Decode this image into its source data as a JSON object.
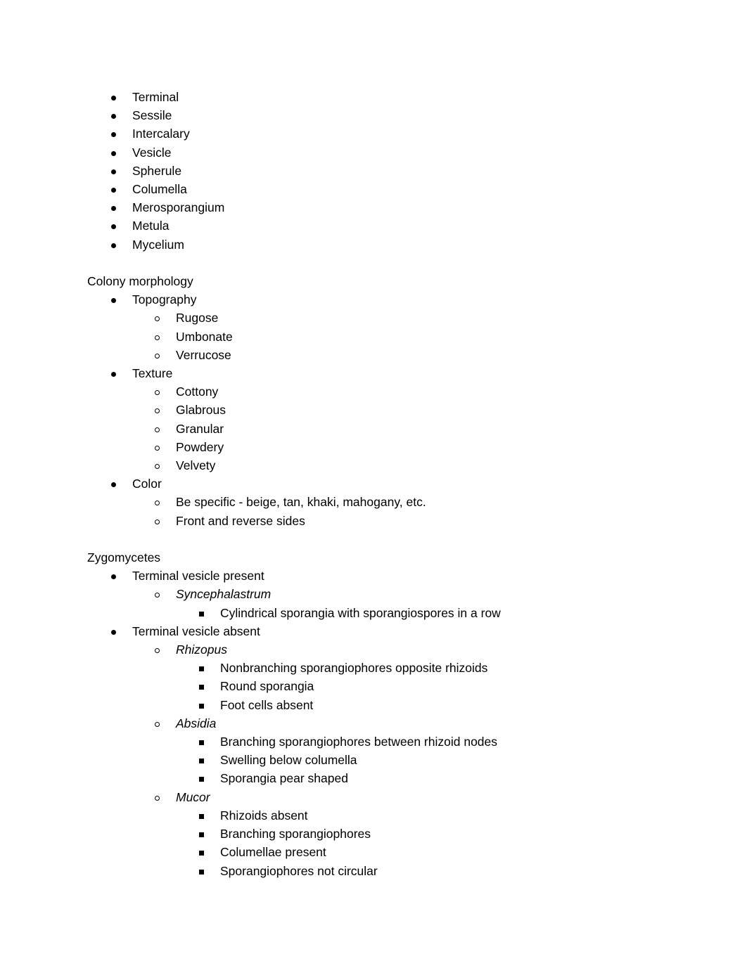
{
  "document": {
    "background_color": "#ffffff",
    "text_color": "#000000",
    "sections": [
      {
        "id": "morphology-terms",
        "heading": null,
        "items": [
          {
            "level": 1,
            "bullet": "disc",
            "text": "Terminal"
          },
          {
            "level": 1,
            "bullet": "disc",
            "text": "Sessile"
          },
          {
            "level": 1,
            "bullet": "disc",
            "text": "Intercalary"
          },
          {
            "level": 1,
            "bullet": "disc",
            "text": "Vesicle"
          },
          {
            "level": 1,
            "bullet": "disc",
            "text": "Spherule"
          },
          {
            "level": 1,
            "bullet": "disc",
            "text": "Columella"
          },
          {
            "level": 1,
            "bullet": "disc",
            "text": "Merosporangium"
          },
          {
            "level": 1,
            "bullet": "disc",
            "text": "Metula"
          },
          {
            "level": 1,
            "bullet": "disc",
            "text": "Mycelium"
          }
        ]
      },
      {
        "id": "colony-morphology",
        "heading": "Colony morphology",
        "items": [
          {
            "level": 1,
            "bullet": "disc",
            "text": "Topography"
          },
          {
            "level": 2,
            "bullet": "circle",
            "text": "Rugose"
          },
          {
            "level": 2,
            "bullet": "circle",
            "text": "Umbonate"
          },
          {
            "level": 2,
            "bullet": "circle",
            "text": "Verrucose"
          },
          {
            "level": 1,
            "bullet": "disc",
            "text": "Texture"
          },
          {
            "level": 2,
            "bullet": "circle",
            "text": "Cottony"
          },
          {
            "level": 2,
            "bullet": "circle",
            "text": "Glabrous"
          },
          {
            "level": 2,
            "bullet": "circle",
            "text": "Granular"
          },
          {
            "level": 2,
            "bullet": "circle",
            "text": "Powdery"
          },
          {
            "level": 2,
            "bullet": "circle",
            "text": "Velvety"
          },
          {
            "level": 1,
            "bullet": "disc",
            "text": "Color"
          },
          {
            "level": 2,
            "bullet": "circle",
            "text": "Be specific - beige, tan, khaki, mahogany, etc."
          },
          {
            "level": 2,
            "bullet": "circle",
            "text": "Front and reverse sides"
          }
        ]
      },
      {
        "id": "zygomycetes",
        "heading": "Zygomycetes",
        "items": [
          {
            "level": 1,
            "bullet": "disc",
            "text": "Terminal vesicle present"
          },
          {
            "level": 2,
            "bullet": "circle",
            "text": "Syncephalastrum",
            "italic": true
          },
          {
            "level": 3,
            "bullet": "square",
            "text": "Cylindrical sporangia with sporangiospores in a row"
          },
          {
            "level": 1,
            "bullet": "disc",
            "text": "Terminal vesicle absent"
          },
          {
            "level": 2,
            "bullet": "circle",
            "text": "Rhizopus",
            "italic": true
          },
          {
            "level": 3,
            "bullet": "square",
            "text": "Nonbranching sporangiophores opposite rhizoids"
          },
          {
            "level": 3,
            "bullet": "square",
            "text": "Round sporangia"
          },
          {
            "level": 3,
            "bullet": "square",
            "text": "Foot cells absent"
          },
          {
            "level": 2,
            "bullet": "circle",
            "text": "Absidia",
            "italic": true
          },
          {
            "level": 3,
            "bullet": "square",
            "text": "Branching sporangiophores between rhizoid nodes"
          },
          {
            "level": 3,
            "bullet": "square",
            "text": "Swelling below columella"
          },
          {
            "level": 3,
            "bullet": "square",
            "text": "Sporangia pear shaped"
          },
          {
            "level": 2,
            "bullet": "circle",
            "text": "Mucor",
            "italic": true
          },
          {
            "level": 3,
            "bullet": "square",
            "text": "Rhizoids absent"
          },
          {
            "level": 3,
            "bullet": "square",
            "text": "Branching sporangiophores"
          },
          {
            "level": 3,
            "bullet": "square",
            "text": "Columellae present"
          },
          {
            "level": 3,
            "bullet": "square",
            "text": "Sporangiophores not circular"
          }
        ]
      }
    ]
  }
}
